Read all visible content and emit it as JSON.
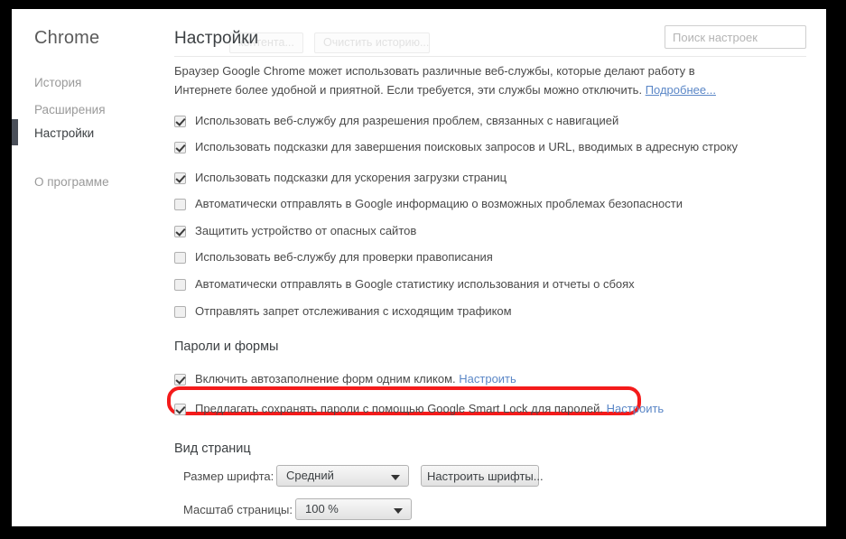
{
  "sidebar": {
    "brand": "Chrome",
    "items": [
      {
        "label": "История",
        "active": false
      },
      {
        "label": "Расширения",
        "active": false
      },
      {
        "label": "Настройки",
        "active": true
      },
      {
        "label": "О программе",
        "active": false
      }
    ]
  },
  "header": {
    "title": "Настройки",
    "ghost_buttons": [
      "контента...",
      "Очистить историю..."
    ],
    "search_placeholder": "Поиск настроек",
    "search_value": ""
  },
  "intro": {
    "text": "Браузер Google Chrome может использовать различные веб-службы, которые делают работу в Интернете более удобной и приятной. Если требуется, эти службы можно отключить.",
    "link": "Подробнее..."
  },
  "privacy_checkboxes": [
    {
      "label": "Использовать веб-службу для разрешения проблем, связанных с навигацией",
      "checked": true
    },
    {
      "label": "Использовать подсказки для завершения поисковых запросов и URL, вводимых в адресную строку",
      "checked": true
    },
    {
      "label": "Использовать подсказки для ускорения загрузки страниц",
      "checked": true
    },
    {
      "label": "Автоматически отправлять в Google информацию о возможных проблемах безопасности",
      "checked": false
    },
    {
      "label": "Защитить устройство от опасных сайтов",
      "checked": true
    },
    {
      "label": "Использовать веб-службу для проверки правописания",
      "checked": false
    },
    {
      "label": "Автоматически отправлять в Google статистику использования и отчеты о сбоях",
      "checked": false
    },
    {
      "label": "Отправлять запрет отслеживания с исходящим трафиком",
      "checked": false
    }
  ],
  "passwords_section": {
    "heading": "Пароли и формы",
    "rows": [
      {
        "label": "Включить автозаполнение форм одним кликом.",
        "link": "Настроить",
        "checked": true,
        "highlighted": false
      },
      {
        "label": "Предлагать сохранять пароли с помощью Google Smart Lock для паролей.",
        "link": "Настроить",
        "checked": true,
        "highlighted": true
      }
    ]
  },
  "appearance_section": {
    "heading": "Вид страниц",
    "font_size_label": "Размер шрифта:",
    "font_size_value": "Средний",
    "customize_fonts_button": "Настроить шрифты...",
    "page_zoom_label": "Масштаб страницы:",
    "page_zoom_value": "100 %"
  },
  "colors": {
    "highlight": "#f41b1b",
    "link": "#5b87c7",
    "active_nav": "#3c4043",
    "inactive_nav": "#9a9a9a",
    "frame": "#000000"
  }
}
